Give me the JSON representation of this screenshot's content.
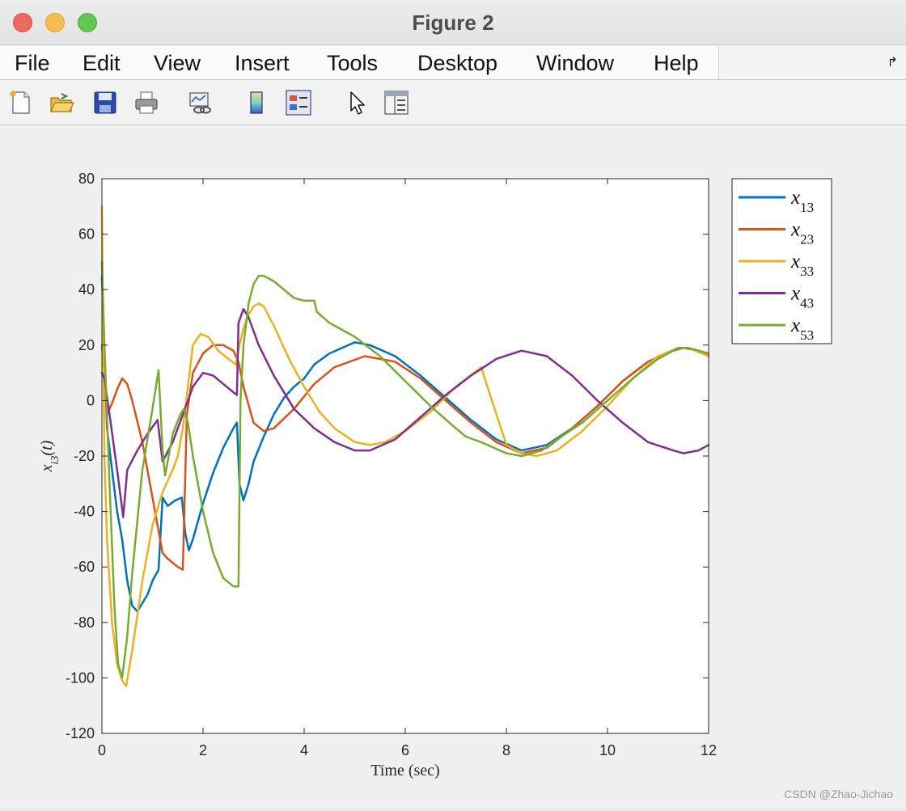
{
  "window": {
    "title": "Figure 2"
  },
  "menu": [
    "File",
    "Edit",
    "View",
    "Insert",
    "Tools",
    "Desktop",
    "Window",
    "Help"
  ],
  "toolbar_icons": [
    "new-figure-icon",
    "open-file-icon",
    "save-icon",
    "print-icon",
    "link-plot-icon",
    "colorbar-icon",
    "legend-icon",
    "pointer-icon",
    "property-inspector-icon"
  ],
  "watermark": "CSDN @Zhao-Jichao",
  "chart_data": {
    "type": "line",
    "title": "",
    "xlabel": "Time (sec)",
    "ylabel": "x_i3(t)",
    "xlim": [
      0,
      12
    ],
    "ylim": [
      -120,
      80
    ],
    "xticks": [
      0,
      2,
      4,
      6,
      8,
      10,
      12
    ],
    "yticks": [
      80,
      60,
      40,
      20,
      0,
      -20,
      -40,
      -60,
      -80,
      -100,
      -120
    ],
    "grid": false,
    "legend_position": "outside-right-top",
    "series": [
      {
        "name": "x13",
        "color": "#0072BD",
        "x": [
          0,
          0.1,
          0.2,
          0.3,
          0.4,
          0.5,
          0.6,
          0.7,
          0.9,
          1.0,
          1.12,
          1.2,
          1.3,
          1.45,
          1.58,
          1.65,
          1.72,
          1.8,
          2.0,
          2.2,
          2.4,
          2.6,
          2.67,
          2.72,
          2.8,
          2.9,
          3.0,
          3.2,
          3.4,
          3.6,
          3.8,
          4.0,
          4.2,
          4.5,
          5.0,
          5.3,
          5.8,
          6.3,
          6.8,
          7.3,
          7.8,
          8.3,
          8.8,
          9.3,
          9.8,
          10.3,
          10.8,
          11.3,
          11.5,
          11.8,
          12.0
        ],
        "y": [
          45,
          -10,
          -25,
          -40,
          -50,
          -65,
          -74,
          -76,
          -70,
          -65,
          -61,
          -35,
          -38,
          -36,
          -35,
          -48,
          -54,
          -50,
          -37,
          -26,
          -17,
          -10,
          -8,
          -30,
          -36,
          -30,
          -22,
          -13,
          -5,
          1,
          5,
          8,
          13,
          17,
          21,
          20,
          16,
          9,
          1,
          -7,
          -14,
          -18,
          -16,
          -10,
          -2,
          7,
          14,
          18,
          19,
          18,
          16
        ]
      },
      {
        "name": "x23",
        "color": "#D95319",
        "x": [
          0,
          0.1,
          0.2,
          0.3,
          0.4,
          0.5,
          0.6,
          0.8,
          1.0,
          1.2,
          1.3,
          1.5,
          1.6,
          1.68,
          1.8,
          2.0,
          2.2,
          2.4,
          2.6,
          2.7,
          2.8,
          3.0,
          3.2,
          3.4,
          3.8,
          4.2,
          4.6,
          5.2,
          5.8,
          6.3,
          6.8,
          7.3,
          7.8,
          8.3,
          8.8,
          9.3,
          9.8,
          10.3,
          10.8,
          11.3,
          11.5,
          11.8,
          12.0
        ],
        "y": [
          20,
          -5,
          -1,
          4,
          8,
          6,
          0,
          -15,
          -35,
          -55,
          -57,
          -60,
          -61,
          -5,
          10,
          17,
          20,
          20,
          18,
          14,
          5,
          -8,
          -11,
          -10,
          -3,
          6,
          12,
          16,
          14,
          8,
          0,
          -8,
          -15,
          -19,
          -17,
          -10,
          -2,
          7,
          14,
          18,
          19,
          18,
          16
        ]
      },
      {
        "name": "x33",
        "color": "#EDB120",
        "x": [
          0,
          0.05,
          0.1,
          0.2,
          0.3,
          0.4,
          0.48,
          0.6,
          0.8,
          1.0,
          1.2,
          1.3,
          1.4,
          1.5,
          1.6,
          1.7,
          1.8,
          1.95,
          2.1,
          2.3,
          2.5,
          2.65,
          2.72,
          2.8,
          2.9,
          3.0,
          3.1,
          3.2,
          3.4,
          3.7,
          4.0,
          4.3,
          4.6,
          5.0,
          5.3,
          5.6,
          6.0,
          6.5,
          7.0,
          7.5,
          8.0,
          8.3,
          8.6,
          9.0,
          9.5,
          10.0,
          10.5,
          11.0,
          11.4,
          11.6,
          12.0
        ],
        "y": [
          70,
          -20,
          -50,
          -80,
          -95,
          -101,
          -103,
          -90,
          -65,
          -45,
          -33,
          -29,
          -25,
          -20,
          -10,
          5,
          20,
          24,
          23,
          18,
          15,
          13,
          20,
          26,
          31,
          34,
          35,
          34,
          27,
          15,
          5,
          -4,
          -10,
          -15,
          -16,
          -15,
          -11,
          -4,
          5,
          12,
          -16,
          -19,
          -20,
          -18,
          -11,
          -2,
          8,
          16,
          19,
          19,
          16
        ]
      },
      {
        "name": "x43",
        "color": "#7E2F8E",
        "x": [
          0,
          0.05,
          0.15,
          0.3,
          0.42,
          0.5,
          0.7,
          0.9,
          1.1,
          1.2,
          1.4,
          1.6,
          1.8,
          2.0,
          2.2,
          2.4,
          2.6,
          2.67,
          2.7,
          2.8,
          2.9,
          3.1,
          3.4,
          3.8,
          4.2,
          4.6,
          5.0,
          5.3,
          5.8,
          6.3,
          6.8,
          7.3,
          7.8,
          8.3,
          8.8,
          9.3,
          9.8,
          10.3,
          10.8,
          11.3,
          11.5,
          11.8,
          12.0
        ],
        "y": [
          10,
          8,
          -5,
          -25,
          -42,
          -25,
          -18,
          -12,
          -7,
          -22,
          -15,
          -5,
          5,
          10,
          9,
          6,
          3,
          2,
          28,
          33,
          30,
          20,
          9,
          -3,
          -10,
          -15,
          -18,
          -18,
          -14,
          -6,
          2,
          9,
          15,
          18,
          16,
          9,
          0,
          -8,
          -15,
          -18,
          -19,
          -18,
          -16
        ]
      },
      {
        "name": "x53",
        "color": "#77AC30",
        "x": [
          0,
          0.05,
          0.15,
          0.25,
          0.32,
          0.4,
          0.5,
          0.6,
          0.8,
          1.0,
          1.12,
          1.2,
          1.25,
          1.4,
          1.55,
          1.62,
          1.7,
          1.8,
          2.0,
          2.2,
          2.4,
          2.6,
          2.7,
          2.74,
          2.8,
          2.9,
          3.0,
          3.1,
          3.2,
          3.4,
          3.6,
          3.8,
          4.0,
          4.2,
          4.25,
          4.5,
          5.0,
          5.5,
          6.0,
          6.5,
          7.0,
          7.2,
          7.5,
          8.0,
          8.3,
          8.7,
          9.0,
          9.5,
          10.0,
          10.5,
          11.0,
          11.4,
          11.6,
          12.0
        ],
        "y": [
          50,
          20,
          -30,
          -75,
          -95,
          -100,
          -85,
          -62,
          -25,
          -3,
          11,
          -18,
          -27,
          -12,
          -5,
          -3,
          -8,
          -20,
          -40,
          -55,
          -64,
          -67,
          -67,
          0,
          20,
          35,
          42,
          45,
          45,
          43,
          40,
          37,
          36,
          36,
          32,
          28,
          23,
          16,
          7,
          -2,
          -10,
          -13,
          -15,
          -19,
          -20,
          -18,
          -14,
          -8,
          0,
          8,
          15,
          19,
          19,
          17
        ]
      }
    ]
  }
}
